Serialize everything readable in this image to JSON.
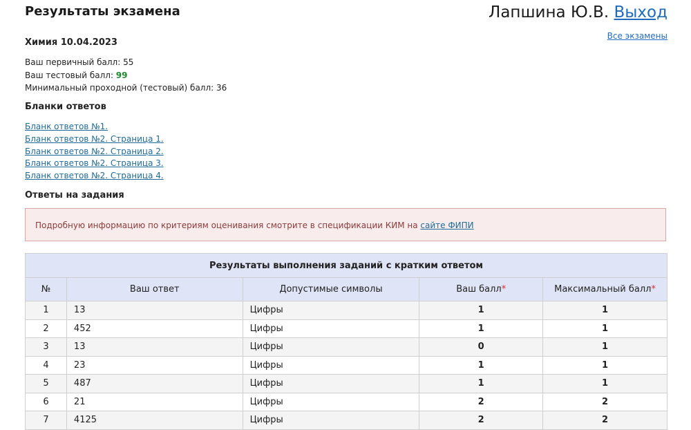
{
  "page_title": "Результаты экзамена",
  "user_name": "Лапшина Ю.В.",
  "logout_label": "Выход",
  "all_exams_label": "Все экзамены",
  "exam": {
    "heading": "Химия 10.04.2023",
    "primary_label": "Ваш первичный балл: ",
    "primary_value": "55",
    "test_label": "Ваш тестовый балл: ",
    "test_value": "99",
    "min_label": "Минимальный проходной (тестовый) балл: ",
    "min_value": "36"
  },
  "blanks": {
    "heading": "Бланки ответов",
    "links": [
      "Бланк ответов №1.",
      "Бланк ответов №2. Страница 1.",
      "Бланк ответов №2. Страница 2.",
      "Бланк ответов №2. Страница 3.",
      "Бланк ответов №2. Страница 4."
    ]
  },
  "answers_heading": "Ответы на задания",
  "alert": {
    "text": "Подробную информацию по критериям оценивания смотрите в спецификации КИМ на ",
    "link": "сайте ФИПИ"
  },
  "table": {
    "caption": "Результаты выполнения заданий с кратким ответом",
    "columns": [
      "№",
      "Ваш ответ",
      "Допустимые символы",
      "Ваш балл",
      "Максимальный балл"
    ],
    "required_mark": "*",
    "rows": [
      {
        "num": "1",
        "answer": "13",
        "symbols": "Цифры",
        "score": "1",
        "max": "1"
      },
      {
        "num": "2",
        "answer": "452",
        "symbols": "Цифры",
        "score": "1",
        "max": "1"
      },
      {
        "num": "3",
        "answer": "13",
        "symbols": "Цифры",
        "score": "0",
        "max": "1"
      },
      {
        "num": "4",
        "answer": "23",
        "symbols": "Цифры",
        "score": "1",
        "max": "1"
      },
      {
        "num": "5",
        "answer": "487",
        "symbols": "Цифры",
        "score": "1",
        "max": "1"
      },
      {
        "num": "6",
        "answer": "21",
        "symbols": "Цифры",
        "score": "2",
        "max": "2"
      },
      {
        "num": "7",
        "answer": "4125",
        "symbols": "Цифры",
        "score": "2",
        "max": "2"
      }
    ]
  },
  "colors": {
    "link": "#1f6bbf",
    "test_score": "#1e8a2e",
    "table_header": "#dfe4f6",
    "alert_bg": "#f9ecec",
    "alert_text": "#8c3b3b"
  }
}
